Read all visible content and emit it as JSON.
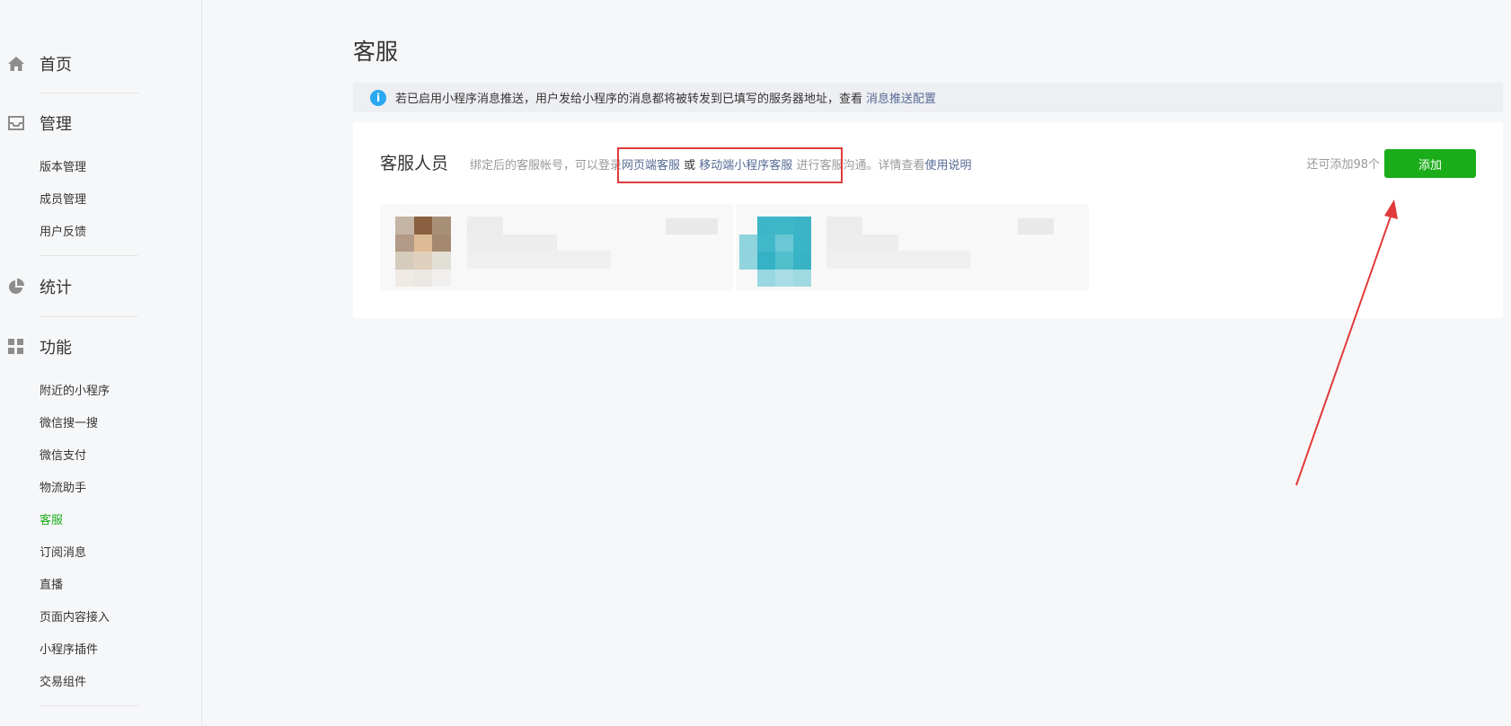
{
  "sidebar": {
    "sections": [
      {
        "icon": "home-icon",
        "label": "首页",
        "items": []
      },
      {
        "icon": "inbox-icon",
        "label": "管理",
        "items": [
          "版本管理",
          "成员管理",
          "用户反馈"
        ]
      },
      {
        "icon": "pie-chart-icon",
        "label": "统计",
        "items": []
      },
      {
        "icon": "grid-icon",
        "label": "功能",
        "items": [
          "附近的小程序",
          "微信搜一搜",
          "微信支付",
          "物流助手",
          "客服",
          "订阅消息",
          "直播",
          "页面内容接入",
          "小程序插件",
          "交易组件"
        ]
      }
    ],
    "active_item": "客服"
  },
  "page": {
    "title": "客服"
  },
  "notice": {
    "icon": "info-icon",
    "text": "若已启用小程序消息推送，用户发给小程序的消息都将被转发到已填写的服务器地址，查看",
    "link": "消息推送配置"
  },
  "panel": {
    "title": "客服人员",
    "desc_prefix": "绑定后的客服帐号，可以登录",
    "link_web": "网页端客服",
    "or_text": " 或 ",
    "link_mobile": "移动端小程序客服",
    "desc_suffix": " 进行客服沟通。详情查看",
    "link_help": "使用说明",
    "remaining": "还可添加98个",
    "add_button": "添加"
  },
  "colors": {
    "accent_green": "#1aad19",
    "link_blue": "#576b95",
    "info_blue": "#2aa8f0",
    "annotation_red": "#e03a3a"
  }
}
